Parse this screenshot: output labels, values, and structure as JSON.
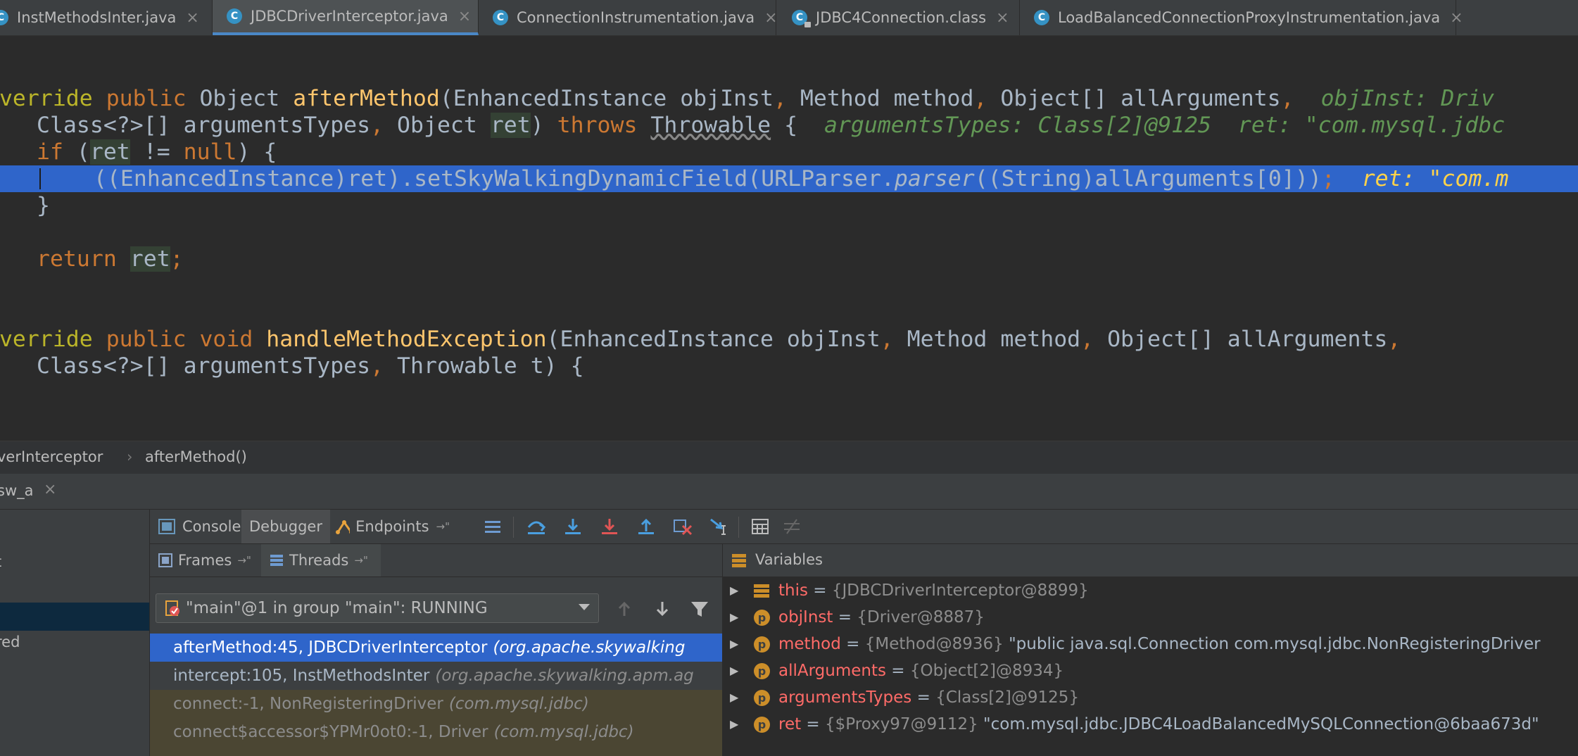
{
  "tabs": [
    {
      "label": "InstMethodsInter.java",
      "active": false,
      "locked": false
    },
    {
      "label": "JDBCDriverInterceptor.java",
      "active": true,
      "locked": false
    },
    {
      "label": "ConnectionInstrumentation.java",
      "active": false,
      "locked": false
    },
    {
      "label": "JDBC4Connection.class",
      "active": false,
      "locked": true
    },
    {
      "label": "LoadBalancedConnectionProxyInstrumentation.java",
      "active": false,
      "locked": false
    }
  ],
  "tab_icon_letter": "C",
  "tab_close_glyph": "×",
  "editor": {
    "l1": {
      "annotation": "Override",
      "kw_public": "public",
      "type": "Object",
      "method": "afterMethod",
      "params": "(EnhancedInstance objInst",
      "comma1": ",",
      "p2": " Method method",
      "comma2": ",",
      "p3": " Object[] allArguments",
      "comma3": ",",
      "hint": "objInst: Driv"
    },
    "l2": {
      "p4": "Class<?>[] argumentsTypes",
      "comma": ",",
      "p5": " Object ",
      "ret": "ret",
      "close": ") ",
      "throws": "throws",
      "throwable": "Throwable",
      "brace": " {",
      "hint": "argumentsTypes: Class[2]@9125  ret: \"com.mysql.jdbc"
    },
    "l3": {
      "kw_if": "if",
      "open": " (",
      "ret": "ret",
      "rest": " != ",
      "null": "null",
      "close": ") {"
    },
    "l4": {
      "code1": "((EnhancedInstance)ret).setSkyWalkingDynamicField(URLParser.",
      "parser": "parser",
      "code2": "((String)allArguments[",
      "zero": "0",
      "code3": "]))",
      "semi": ";",
      "hint": "ret: \"com.m"
    },
    "l5": {
      "brace": "}"
    },
    "l6": {
      "kw_return": "return",
      "ret": "ret",
      "semi": ";"
    },
    "l7": {
      "annotation": "Override",
      "kw_public": "public",
      "kw_void": "void",
      "method": "handleMethodException",
      "params": "(EnhancedInstance objInst",
      "comma1": ",",
      "p2": " Method method",
      "comma2": ",",
      "p3": " Object[] allArguments",
      "comma3": ","
    },
    "l8": {
      "p4": "Class<?>[] argumentsTypes",
      "comma": ",",
      "p5": " Throwable t) {"
    }
  },
  "breadcrumb": {
    "class_name": "verInterceptor",
    "separator": "›",
    "method": "afterMethod()"
  },
  "debug_tab": {
    "label": "sw_a",
    "close": "×"
  },
  "left_panel": {
    "item1": "t",
    "item2": "red"
  },
  "toolbar": {
    "console": "Console",
    "debugger": "Debugger",
    "endpoints": "Endpoints",
    "pin": "→\""
  },
  "frames_header": {
    "frames": "Frames",
    "threads": "Threads",
    "pin": "→\""
  },
  "thread_select": {
    "value": "\"main\"@1 in group \"main\": RUNNING"
  },
  "frames": [
    {
      "name": "afterMethod:45, JDBCDriverInterceptor",
      "pkg": "(org.apache.skywalking",
      "state": "selected"
    },
    {
      "name": "intercept:105, InstMethodsInter",
      "pkg": "(org.apache.skywalking.apm.ag",
      "state": "normal"
    },
    {
      "name": "connect:-1, NonRegisteringDriver",
      "pkg": "(com.mysql.jdbc)",
      "state": "library"
    },
    {
      "name": "connect$accessor$YPMr0ot0:-1, Driver",
      "pkg": "(com.mysql.jdbc)",
      "state": "library"
    }
  ],
  "variables_header": {
    "title": "Variables"
  },
  "variables": [
    {
      "icon": "this",
      "name": "this",
      "eq": " = ",
      "ref": "{JDBCDriverInterceptor@8899}",
      "value": ""
    },
    {
      "icon": "p",
      "name": "objInst",
      "eq": " = ",
      "ref": "{Driver@8887}",
      "value": ""
    },
    {
      "icon": "p",
      "name": "method",
      "eq": " = ",
      "ref": "{Method@8936}",
      "value": " \"public java.sql.Connection com.mysql.jdbc.NonRegisteringDriver"
    },
    {
      "icon": "p",
      "name": "allArguments",
      "eq": " = ",
      "ref": "{Object[2]@8934}",
      "value": ""
    },
    {
      "icon": "p",
      "name": "argumentsTypes",
      "eq": " = ",
      "ref": "{Class[2]@9125}",
      "value": ""
    },
    {
      "icon": "p",
      "name": "ret",
      "eq": " = ",
      "ref": "{$Proxy97@9112}",
      "value": " \"com.mysql.jdbc.JDBC4LoadBalancedMySQLConnection@6baa673d\""
    }
  ],
  "colors": {
    "editor_bg": "#2b2b2b",
    "selection_line": "#2f65ca",
    "keyword": "#cc7832",
    "method_name": "#ffc66d",
    "inline_hint": "#629755",
    "variable_name": "#ff6b68",
    "library_frame_bg": "#4b4633"
  }
}
